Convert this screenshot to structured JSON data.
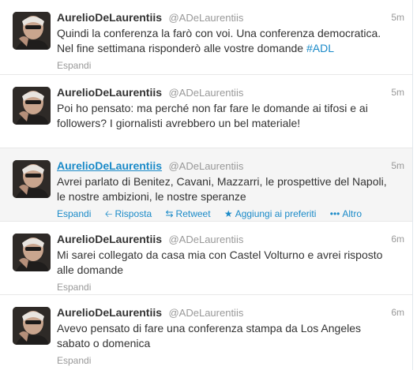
{
  "tweets": [
    {
      "name": "AurelioDeLaurentiis",
      "handle": "@ADeLaurentiis",
      "time": "5m",
      "text": "Quindi la conferenza la farò con voi. Una conferenza democratica. Nel fine settimana risponderò alle vostre domande ",
      "hashtag": "#ADL",
      "expand": "Espandi"
    },
    {
      "name": "AurelioDeLaurentiis",
      "handle": "@ADeLaurentiis",
      "time": "5m",
      "text": "Poi ho pensato: ma perché non far fare le domande ai tifosi e ai followers? I giornalisti avrebbero un bel materiale!",
      "expand": "Espandi"
    },
    {
      "name": "AurelioDeLaurentiis",
      "handle": "@ADeLaurentiis",
      "time": "5m",
      "text": "Avrei parlato di Benitez, Cavani, Mazzarri, le prospettive del Napoli, le nostre ambizioni, le nostre speranze",
      "expand": "Espandi",
      "reply": "Risposta",
      "retweet": "Retweet",
      "favorite": "Aggiungi ai preferiti",
      "more": "Altro"
    },
    {
      "name": "AurelioDeLaurentiis",
      "handle": "@ADeLaurentiis",
      "time": "6m",
      "text": "Mi sarei collegato da casa mia con Castel Volturno e avrei risposto alle domande",
      "expand": "Espandi"
    },
    {
      "name": "AurelioDeLaurentiis",
      "handle": "@ADeLaurentiis",
      "time": "6m",
      "text": "Avevo pensato di fare una conferenza stampa da Los Angeles sabato o domenica",
      "expand": "Espandi"
    }
  ],
  "icons": {
    "reply": "reply-icon",
    "retweet": "retweet-icon",
    "favorite": "star-icon",
    "more": "more-dots-icon"
  },
  "colors": {
    "link": "#1a8ac8",
    "text": "#333333",
    "muted": "#999999",
    "hover_bg": "#f5f5f5"
  }
}
